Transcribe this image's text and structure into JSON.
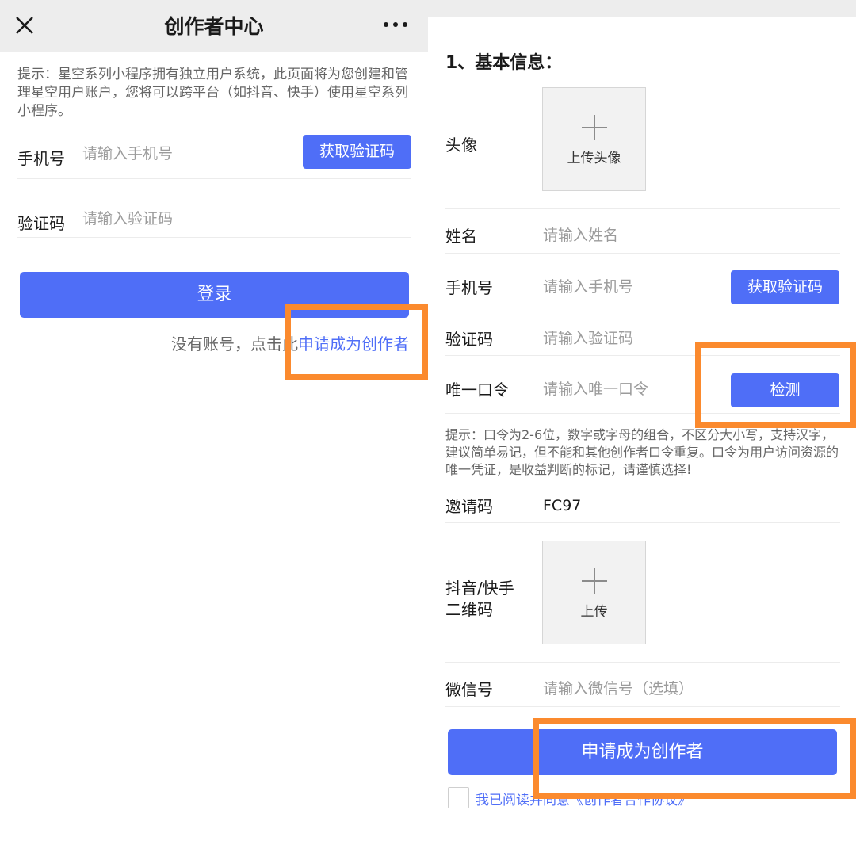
{
  "left": {
    "nav_title": "创作者中心",
    "tip": "提示：星空系列小程序拥有独立用户系统，此页面将为您创建和管理星空用户账户，您将可以跨平台（如抖音、快手）使用星空系列小程序。",
    "phone": {
      "label": "手机号",
      "placeholder": "请输入手机号",
      "button": "获取验证码"
    },
    "code": {
      "label": "验证码",
      "placeholder": "请输入验证码"
    },
    "login_button": "登录",
    "no_account": "没有账号，点击此",
    "apply_link": "申请成为创作者"
  },
  "right": {
    "section_title": "1、基本信息：",
    "avatar": {
      "label": "头像",
      "upload": "上传头像"
    },
    "name": {
      "label": "姓名",
      "placeholder": "请输入姓名"
    },
    "phone": {
      "label": "手机号",
      "placeholder": "请输入手机号",
      "button": "获取验证码"
    },
    "code": {
      "label": "验证码",
      "placeholder": "请输入验证码"
    },
    "token": {
      "label": "唯一口令",
      "placeholder": "请输入唯一口令",
      "button": "检测"
    },
    "tip": "提示：口令为2-6位，数字或字母的组合，不区分大小写，支持汉字，建议简单易记，但不能和其他创作者口令重复。口令为用户访问资源的唯一凭证，是收益判断的标记，请谨慎选择!",
    "invite": {
      "label": "邀请码",
      "value": "FC97"
    },
    "qrcode": {
      "label_line1": "抖音/快手",
      "label_line2": "二维码",
      "upload": "上传"
    },
    "wechat": {
      "label": "微信号",
      "placeholder": "请输入微信号（选填）"
    },
    "apply_button": "申请成为创作者",
    "agreement": "我已阅读并同意《创作者合作协议》"
  },
  "colors": {
    "accent": "#4f6ef7",
    "highlight": "#fb8a2e",
    "topbar": "#ededed"
  },
  "icons": [
    "close-icon",
    "more-icon",
    "plus-icon"
  ]
}
